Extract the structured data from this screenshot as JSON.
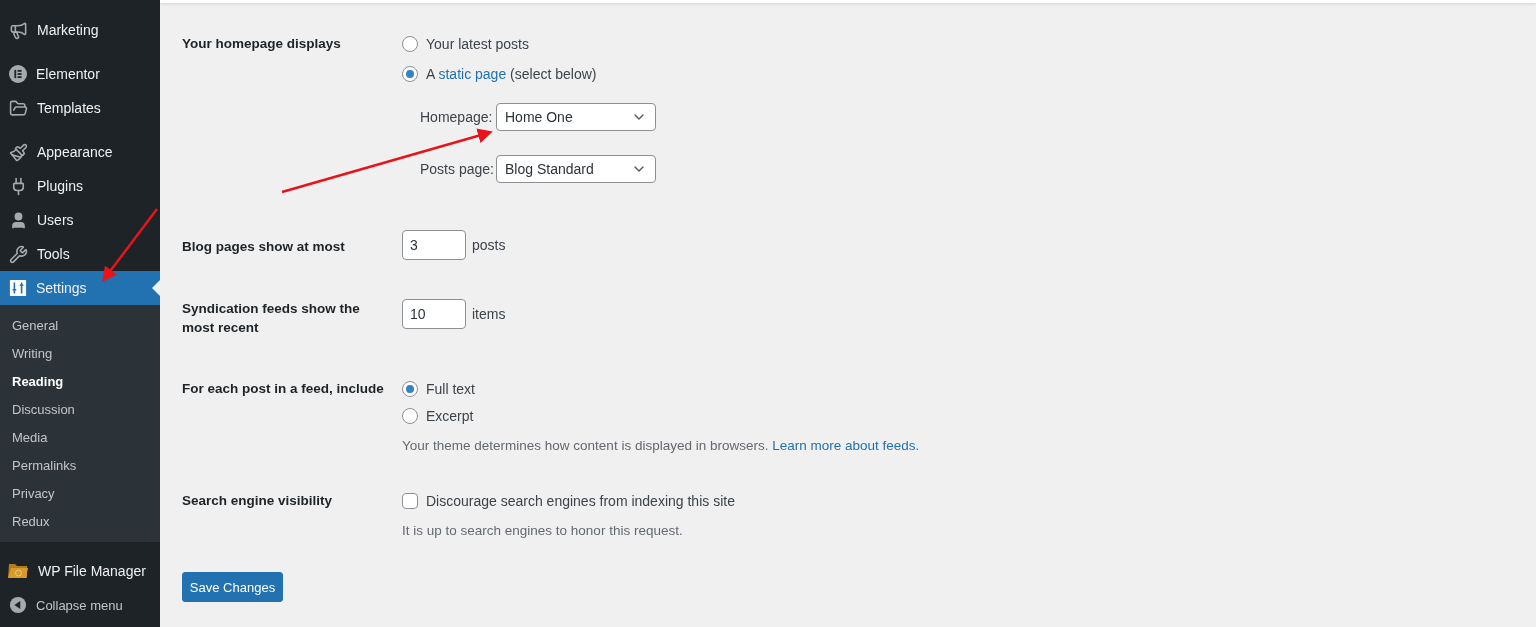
{
  "sidebar": {
    "menu_groups": [
      [
        {
          "label": "Marketing",
          "selected": false
        }
      ],
      [
        {
          "label": "Elementor",
          "selected": false
        },
        {
          "label": "Templates",
          "selected": false
        }
      ],
      [
        {
          "label": "Appearance",
          "selected": false
        },
        {
          "label": "Plugins",
          "selected": false
        },
        {
          "label": "Users",
          "selected": false
        },
        {
          "label": "Tools",
          "selected": false
        },
        {
          "label": "Settings",
          "selected": true
        }
      ]
    ],
    "submenu": [
      {
        "label": "General",
        "selected": false
      },
      {
        "label": "Writing",
        "selected": false
      },
      {
        "label": "Reading",
        "selected": true
      },
      {
        "label": "Discussion",
        "selected": false
      },
      {
        "label": "Media",
        "selected": false
      },
      {
        "label": "Permalinks",
        "selected": false
      },
      {
        "label": "Privacy",
        "selected": false
      },
      {
        "label": "Redux",
        "selected": false
      }
    ],
    "plugin_item": {
      "label": "WP File Manager"
    },
    "collapse": {
      "label": "Collapse menu"
    }
  },
  "settings": [
    {
      "kind": "homepage",
      "label": "Your homepage displays",
      "options": [
        {
          "text": "Your latest posts",
          "selected": false
        },
        {
          "text": "A ",
          "link": "static page",
          "after": " (select below)",
          "selected": true
        }
      ],
      "selects": [
        {
          "label": "Homepage:",
          "value": "Home One"
        },
        {
          "label": "Posts page:",
          "value": "Blog Standard"
        }
      ]
    },
    {
      "kind": "number",
      "label": "Blog pages show at most",
      "value": "3",
      "unit": "posts"
    },
    {
      "kind": "number",
      "label": "Syndication feeds show the most recent",
      "value": "10",
      "unit": "items"
    },
    {
      "kind": "radios",
      "label": "For each post in a feed, include",
      "options": [
        {
          "text": "Full text",
          "selected": true
        },
        {
          "text": "Excerpt",
          "selected": false
        }
      ],
      "description": "Your theme determines how content is displayed in browsers.",
      "link": "Learn more about feeds."
    },
    {
      "kind": "checkbox",
      "label": "Search engine visibility",
      "text": "Discourage search engines from indexing this site",
      "checked": false,
      "description": "It is up to search engines to honor this request."
    }
  ],
  "save_button": "Save Changes"
}
